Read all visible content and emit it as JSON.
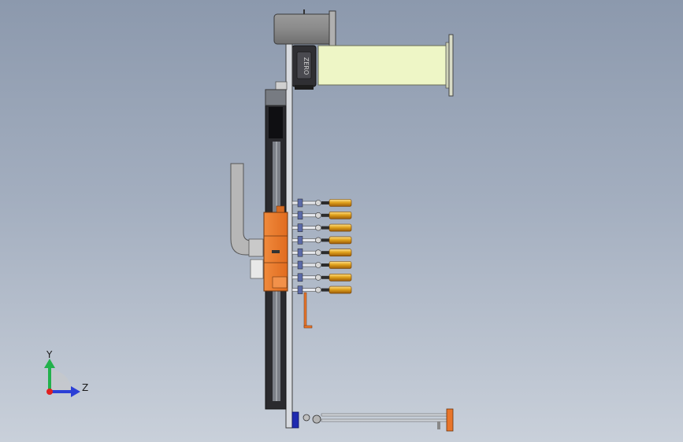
{
  "view": {
    "background_top": "#8c99ad",
    "background_bottom": "#c9d0da"
  },
  "model": {
    "motor_label": "ZERO",
    "accent_orange": "#e8752a",
    "tube_green": "#eef6c6",
    "gripper_count": 8
  },
  "triad": {
    "y_label": "Y",
    "z_label": "Z",
    "y_color": "#22b14c",
    "z_color": "#2b3fd6",
    "origin_color": "#e02020"
  }
}
